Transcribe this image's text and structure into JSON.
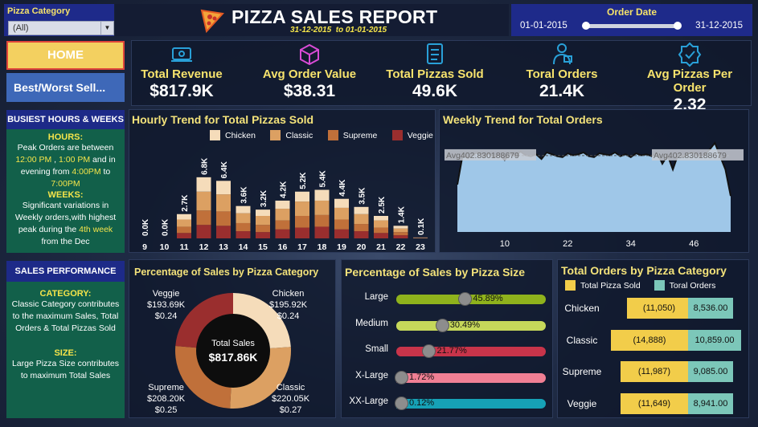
{
  "filter": {
    "label": "Pizza Category",
    "value": "(All)"
  },
  "header": {
    "title": "PIZZA SALES REPORT",
    "subtitle": "31-12-2015  to 01-01-2015"
  },
  "date_filter": {
    "label": "Order Date",
    "start": "01-01-2015",
    "end": "31-12-2015"
  },
  "nav": {
    "home": "HOME",
    "best_worst": "Best/Worst Sell..."
  },
  "kpis": [
    {
      "label": "Total Revenue",
      "value": "$817.9K",
      "icon": "money-icon"
    },
    {
      "label": "Avg Order Value",
      "value": "$38.31",
      "icon": "box-icon"
    },
    {
      "label": "Total Pizzas Sold",
      "value": "49.6K",
      "icon": "checklist-icon"
    },
    {
      "label": "Toral Orders",
      "value": "21.4K",
      "icon": "delivery-person-icon"
    },
    {
      "label": "Avg Pizzas Per Order",
      "value": "2.32",
      "icon": "badge-icon"
    }
  ],
  "busiest": {
    "title": "BUSIEST HOURS & WEEKS",
    "hours_h": "HOURS:",
    "hours_p1": "Peak Orders are between",
    "hours_t1": "12:00 PM",
    "hours_sep1": " , ",
    "hours_t2": "1:00 PM",
    "hours_p2": " and in evening from ",
    "hours_t3": "4:00PM",
    "hours_p3": " to",
    "hours_t4": "7:00PM",
    "weeks_h": "WEEKS:",
    "weeks_p1": "Significant variations in Weekly orders,with highest peak during the ",
    "weeks_t1": "4th week",
    "weeks_p2": " from the Dec"
  },
  "sales_perf": {
    "title": "SALES PERFORMANCE",
    "cat_h": "CATEGORY:",
    "cat_p": "Classic Category contributes to the maximum Sales, Total Orders & Total Pizzas Sold",
    "size_h": "SIZE:",
    "size_p": "Large Pizza Size contributes to maximum Total Sales"
  },
  "hourly": {
    "title": "Hourly Trend for Total Pizzas Sold",
    "legend": [
      "Chicken",
      "Classic",
      "Supreme",
      "Veggie"
    ],
    "colors": {
      "Chicken": "#f5dcba",
      "Classic": "#dca062",
      "Supreme": "#c0703a",
      "Veggie": "#9a2e2e"
    }
  },
  "weekly": {
    "title": "Weekly Trend for Total Orders",
    "avg_label": "Avg402.830188679",
    "fill": "#9fc7e8",
    "line": "#111111"
  },
  "donut": {
    "title": "Percentage of Sales by Pizza Category",
    "center_label": "Total Sales",
    "center_value": "$817.86K",
    "slices": [
      {
        "name": "Chicken",
        "value": "$195.92K",
        "pct": "$0.24"
      },
      {
        "name": "Classic",
        "value": "$220.05K",
        "pct": "$0.27"
      },
      {
        "name": "Supreme",
        "value": "$208.20K",
        "pct": "$0.25"
      },
      {
        "name": "Veggie",
        "value": "$193.69K",
        "pct": "$0.24"
      }
    ]
  },
  "size_chart": {
    "title": "Percentage of Sales by Pizza Size",
    "rows": [
      {
        "name": "Large",
        "pct": 45.89,
        "label": "45.89%",
        "color": "#8fb21c",
        "track": "#8fb21c"
      },
      {
        "name": "Medium",
        "pct": 30.49,
        "label": "30.49%",
        "color": "#c6d85a",
        "track": "#c6d85a"
      },
      {
        "name": "Small",
        "pct": 21.77,
        "label": "21.77%",
        "color": "#c8344a",
        "track": "#c8344a"
      },
      {
        "name": "X-Large",
        "pct": 1.72,
        "label": "1.72%",
        "color": "#f07f94",
        "track": "#f07f94"
      },
      {
        "name": "XX-Large",
        "pct": 0.12,
        "label": "0.12%",
        "color": "#16a1b6",
        "track": "#16a1b6"
      }
    ]
  },
  "orders_cat": {
    "title": "Total Orders by Pizza Category",
    "legend_sold": "Total Pizza Sold",
    "legend_orders": "Toral Orders",
    "rows": [
      {
        "name": "Chicken",
        "sold": "(11,050)",
        "orders": "8,536.00"
      },
      {
        "name": "Classic",
        "sold": "(14,888)",
        "orders": "10,859.00"
      },
      {
        "name": "Supreme",
        "sold": "(11,987)",
        "orders": "9,085.00"
      },
      {
        "name": "Veggie",
        "sold": "(11,649)",
        "orders": "8,941.00"
      }
    ]
  },
  "chart_data": [
    {
      "type": "bar",
      "title": "Hourly Trend for Total Pizzas Sold",
      "categories": [
        "9",
        "10",
        "11",
        "12",
        "13",
        "14",
        "15",
        "16",
        "17",
        "18",
        "19",
        "20",
        "21",
        "22",
        "23"
      ],
      "totals": [
        0.0,
        0.0,
        2.7,
        6.8,
        6.4,
        3.6,
        3.2,
        4.2,
        5.2,
        5.4,
        4.4,
        3.5,
        2.5,
        1.4,
        0.1
      ],
      "total_labels": [
        "0.0K",
        "0.0K",
        "2.7K",
        "6.8K",
        "6.4K",
        "3.6K",
        "3.2K",
        "4.2K",
        "5.2K",
        "5.4K",
        "4.4K",
        "3.5K",
        "2.5K",
        "1.4K",
        "0.1K"
      ],
      "series": [
        {
          "name": "Chicken",
          "values": [
            0.0,
            0.0,
            0.6,
            1.6,
            1.5,
            0.8,
            0.7,
            0.9,
            1.1,
            1.2,
            1.0,
            0.8,
            0.5,
            0.3,
            0.02
          ]
        },
        {
          "name": "Classic",
          "values": [
            0.0,
            0.0,
            0.8,
            2.1,
            1.9,
            1.1,
            1.0,
            1.3,
            1.6,
            1.6,
            1.3,
            1.1,
            0.8,
            0.4,
            0.04
          ]
        },
        {
          "name": "Supreme",
          "values": [
            0.0,
            0.0,
            0.7,
            1.6,
            1.6,
            0.9,
            0.8,
            1.0,
            1.3,
            1.3,
            1.1,
            0.8,
            0.6,
            0.35,
            0.02
          ]
        },
        {
          "name": "Veggie",
          "values": [
            0.0,
            0.0,
            0.6,
            1.5,
            1.4,
            0.8,
            0.7,
            1.0,
            1.2,
            1.3,
            1.0,
            0.8,
            0.6,
            0.35,
            0.02
          ]
        }
      ]
    },
    {
      "type": "area",
      "title": "Weekly Trend for Total Orders",
      "x_ticks": [
        "10",
        "22",
        "34",
        "46"
      ],
      "avg": 402.830188679,
      "ylim": [
        0,
        500
      ],
      "x": [
        1,
        2,
        3,
        4,
        5,
        6,
        7,
        8,
        9,
        10,
        11,
        12,
        13,
        14,
        15,
        16,
        17,
        18,
        19,
        20,
        21,
        22,
        23,
        24,
        25,
        26,
        27,
        28,
        29,
        30,
        31,
        32,
        33,
        34,
        35,
        36,
        37,
        38,
        39,
        40,
        41,
        42,
        43,
        44,
        45,
        46,
        47,
        48,
        49,
        50,
        51,
        52,
        53
      ],
      "values": [
        250,
        405,
        390,
        410,
        420,
        400,
        415,
        395,
        410,
        380,
        415,
        400,
        425,
        405,
        400,
        410,
        385,
        420,
        410,
        400,
        395,
        415,
        405,
        410,
        420,
        400,
        395,
        415,
        410,
        405,
        420,
        400,
        410,
        395,
        415,
        405,
        410,
        400,
        420,
        360,
        405,
        330,
        410,
        395,
        415,
        420,
        400,
        405,
        435,
        470,
        400,
        330,
        190
      ]
    }
  ]
}
